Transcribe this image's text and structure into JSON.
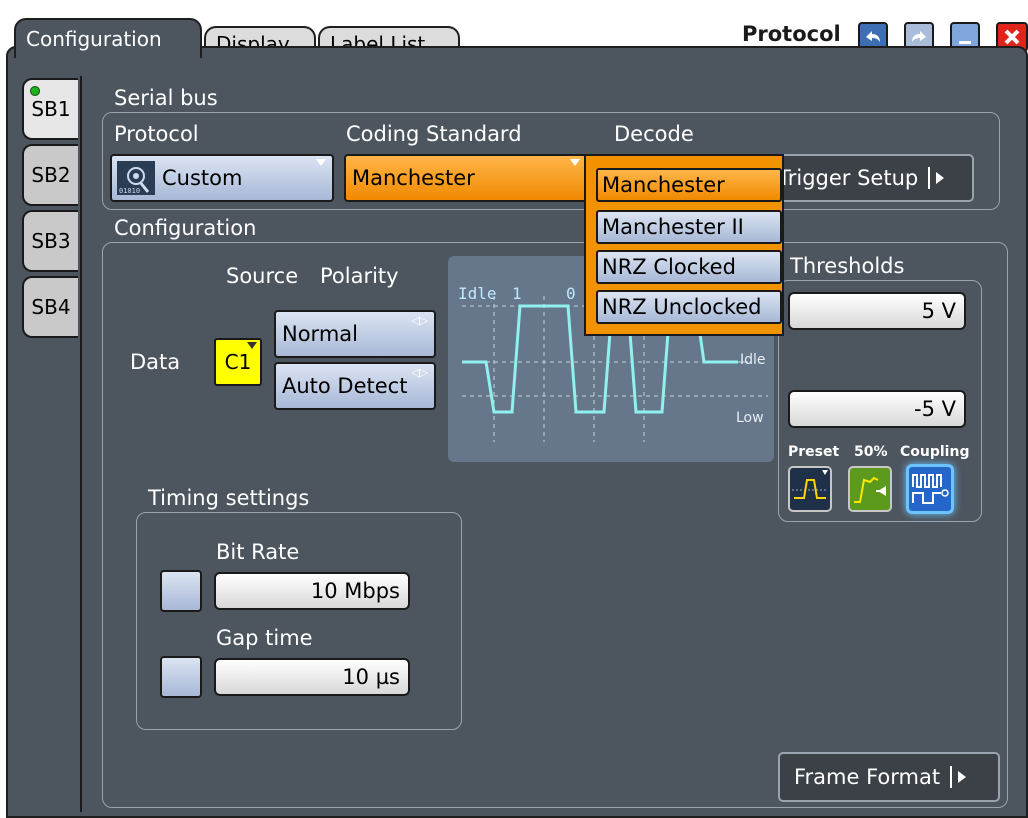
{
  "tabs": [
    {
      "label": "Configuration",
      "active": true
    },
    {
      "label": "Display",
      "active": false
    },
    {
      "label": "Label List",
      "active": false
    }
  ],
  "window_title": "Protocol",
  "sb_tabs": [
    "SB1",
    "SB2",
    "SB3",
    "SB4"
  ],
  "serial_bus": {
    "label": "Serial bus",
    "protocol_label": "Protocol",
    "protocol_value": "Custom",
    "coding_label": "Coding Standard",
    "coding_value": "Manchester",
    "decode_label": "Decode",
    "trigger_setup": "Trigger Setup"
  },
  "coding_dropdown": [
    "Manchester",
    "Manchester II",
    "NRZ Clocked",
    "NRZ Unclocked"
  ],
  "configuration": {
    "label": "Configuration",
    "source_label": "Source",
    "polarity_label": "Polarity",
    "data_label": "Data",
    "source_value": "C1",
    "polarity_value": "Normal",
    "auto_detect": "Auto Detect",
    "diagram": {
      "idle_top": "Idle",
      "bit1": "1",
      "bit0": "0",
      "idle_right": "Idle",
      "low": "Low"
    },
    "thresholds_label": "Thresholds",
    "threshold_high": "5 V",
    "threshold_low": "-5 V",
    "preset_label": "Preset",
    "fifty_label": "50%",
    "coupling_label": "Coupling",
    "timing_label": "Timing settings",
    "bit_rate_label": "Bit Rate",
    "bit_rate_value": "10 Mbps",
    "gap_label": "Gap time",
    "gap_value": "10 µs",
    "frame_format": "Frame Format"
  },
  "colors": {
    "panel": "#4d555f",
    "accent_orange": "#f39200",
    "source_yellow": "#ffff00",
    "status_green": "#1db31d"
  }
}
